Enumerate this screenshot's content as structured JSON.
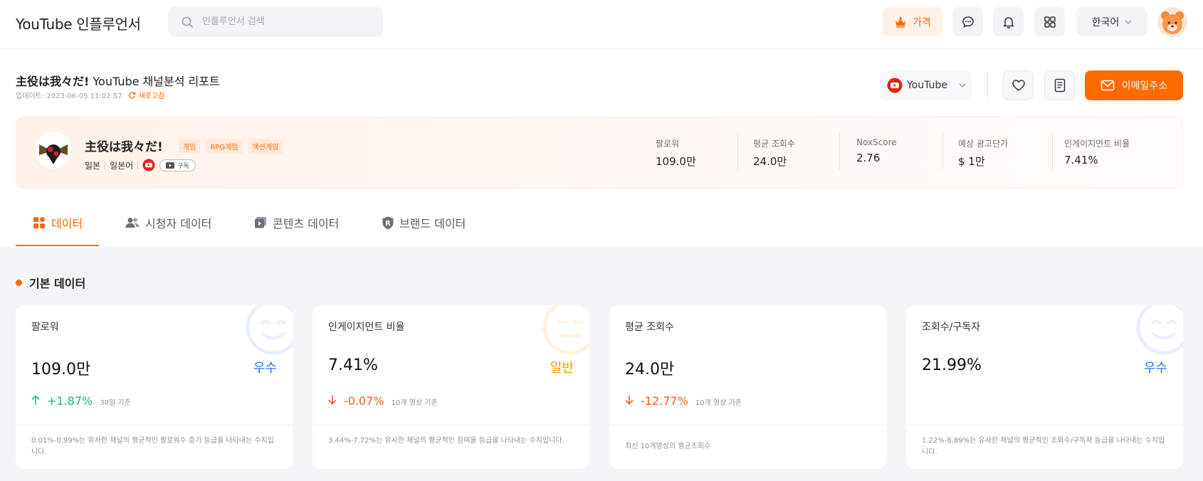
{
  "nav": {
    "logo": "YouTube 인플루언서",
    "search_placeholder": "인플루언서 검색",
    "price_label": "가격",
    "language": "한국어"
  },
  "report": {
    "channel_name": "主役は我々だ!",
    "title_suffix": "YouTube 채널분석 리포트",
    "updated": "업데이트: 2023-06-05 11:02:57",
    "refresh_label": "새로고침",
    "platform": "YouTube",
    "email_label": "이메일주소"
  },
  "channel": {
    "name": "主役は我々だ!",
    "tags": [
      "게임",
      "RPG게임",
      "액션게임"
    ],
    "country": "일본",
    "language": "일본어",
    "subscribe_label": "구독",
    "stats": [
      {
        "label": "팔로워",
        "value": "109.0만"
      },
      {
        "label": "평균 조회수",
        "value": "24.0만"
      },
      {
        "label": "NoxScore",
        "value": "2.76"
      },
      {
        "label": "예상 광고단가",
        "value": "$ 1만"
      },
      {
        "label": "인게이지먼트 비율",
        "value": "7.41%"
      }
    ]
  },
  "tabs": [
    {
      "label": "데이터",
      "icon": "grid-icon",
      "active": true
    },
    {
      "label": "시청자 데이터",
      "icon": "people-icon",
      "active": false
    },
    {
      "label": "콘텐츠 데이터",
      "icon": "video-icon",
      "active": false
    },
    {
      "label": "브랜드 데이터",
      "icon": "brand-shield-icon",
      "active": false
    }
  ],
  "section_title": "기본 데이터",
  "metrics": [
    {
      "label": "팔로워",
      "value": "109.0만",
      "grade": "우수",
      "change": "+1.87%",
      "change_dir": "up",
      "basis": "30일 기준",
      "note": "0.01%-0.99%는 유사한 채널의 평균적인 팔로워수 증가 등급을 나타내는 수치입니다."
    },
    {
      "label": "인게이지먼트 비율",
      "value": "7.41%",
      "grade": "일반",
      "change": "-0.07%",
      "change_dir": "down",
      "basis": "10개 영상 기준",
      "note": "3.44%-7.72%는 유사한 채널의 평균적인 참여율 등급을 나타내는 수치입니다."
    },
    {
      "label": "평균 조회수",
      "value": "24.0만",
      "grade": "",
      "change": "-12.77%",
      "change_dir": "down",
      "basis": "10개 영상 기준",
      "note": "최신 10개영상의 평균조회수"
    },
    {
      "label": "조회수/구독자",
      "value": "21.99%",
      "grade": "우수",
      "change": "",
      "change_dir": "",
      "basis": "",
      "note": "1.22%-8.89%는 유사한 채널의 평균적인 조회수/구독자 등급을 나타내는 수치입니다."
    }
  ],
  "colors": {
    "accent": "#ff6a00",
    "up": "#22b573",
    "down": "#ff5a1f",
    "grade_good": "#2f6ff3",
    "grade_normal": "#ff9d00"
  }
}
